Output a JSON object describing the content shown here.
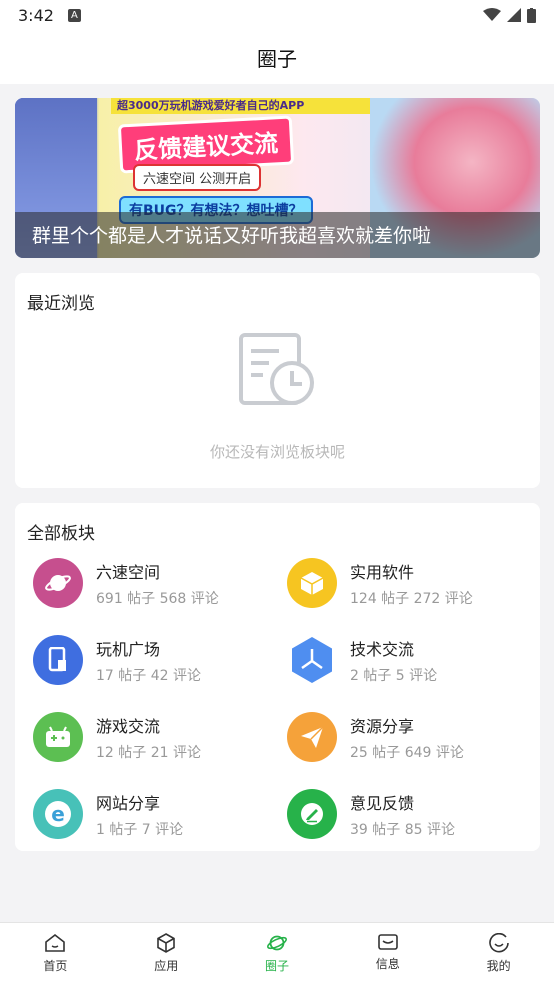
{
  "status": {
    "time": "3:42",
    "badge": "A"
  },
  "header": {
    "title": "圈子"
  },
  "banner": {
    "topline": "超3000万玩机游戏爱好者自己的APP",
    "headline": "反馈建议交流",
    "pill1": "六速空间  公测开启",
    "pill2": "有BUG？有想法？想吐槽？",
    "caption": "群里个个都是人才说话又好听我超喜欢就差你啦"
  },
  "recent": {
    "title": "最近浏览",
    "empty_text": "你还没有浏览板块呢"
  },
  "all": {
    "title": "全部板块",
    "boards": [
      {
        "name": "六速空间",
        "meta": "691 帖子 568 评论",
        "icon": "planet-icon",
        "color": "#c64f8e"
      },
      {
        "name": "实用软件",
        "meta": "124 帖子 272 评论",
        "icon": "box-icon",
        "color": "#f6c521"
      },
      {
        "name": "玩机广场",
        "meta": "17 帖子 42 评论",
        "icon": "phone-icon",
        "color": "#3f6ee0"
      },
      {
        "name": "技术交流",
        "meta": "2 帖子 5 评论",
        "icon": "hexagon-icon",
        "color": "#4f8ef0"
      },
      {
        "name": "游戏交流",
        "meta": "12 帖子 21 评论",
        "icon": "gamepad-icon",
        "color": "#5cbf52"
      },
      {
        "name": "资源分享",
        "meta": "25 帖子 649 评论",
        "icon": "paper-plane-icon",
        "color": "#f5a23a"
      },
      {
        "name": "网站分享",
        "meta": "1 帖子 7 评论",
        "icon": "browser-icon",
        "color": "#47c1b8"
      },
      {
        "name": "意见反馈",
        "meta": "39 帖子 85 评论",
        "icon": "feedback-icon",
        "color": "#27b24a"
      }
    ]
  },
  "tabs": [
    {
      "label": "首页",
      "icon": "home-icon"
    },
    {
      "label": "应用",
      "icon": "cube-icon"
    },
    {
      "label": "圈子",
      "icon": "planet-icon",
      "active": true
    },
    {
      "label": "信息",
      "icon": "mail-icon"
    },
    {
      "label": "我的",
      "icon": "smile-icon"
    }
  ],
  "colors": {
    "accent": "#27b24a"
  }
}
